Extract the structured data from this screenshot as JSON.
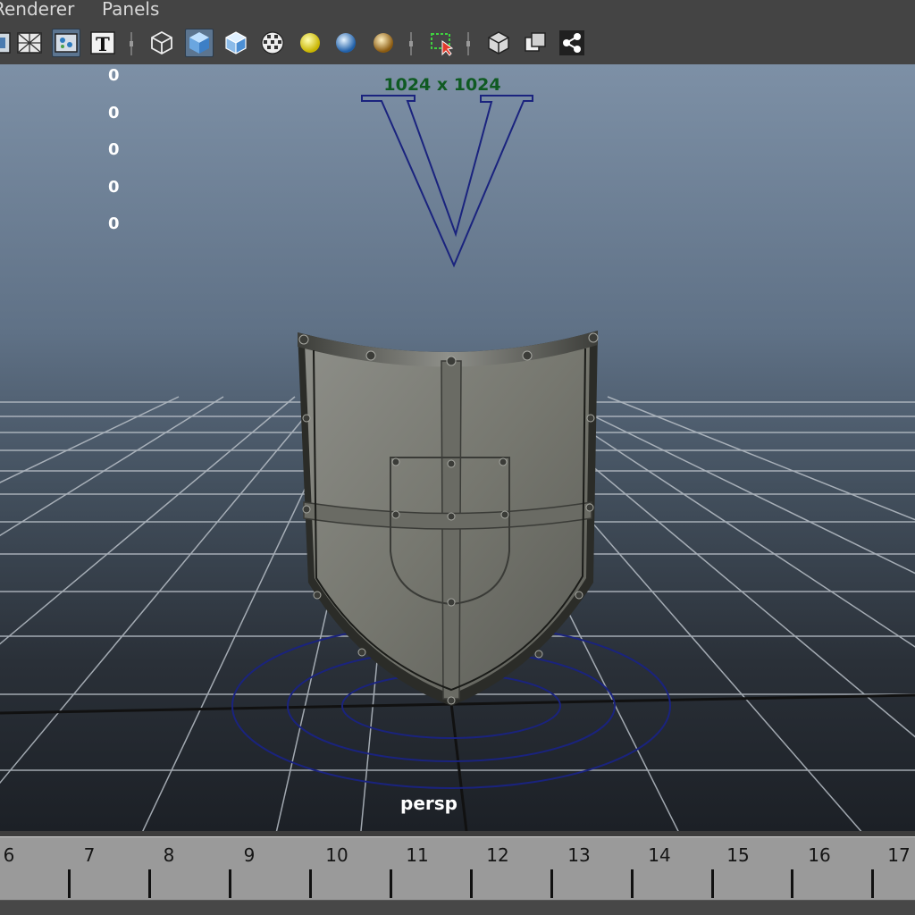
{
  "menu": {
    "items": [
      "Renderer",
      "Panels"
    ]
  },
  "toolbar": {
    "buttons": [
      {
        "icon": "camera-attributes-icon"
      },
      {
        "icon": "grid-icon"
      },
      {
        "icon": "resolution-gate-icon",
        "active": true
      },
      {
        "icon": "hud-text-icon"
      },
      {
        "icon": "wireframe-cube-icon"
      },
      {
        "icon": "smooth-shade-cube-icon",
        "active": true
      },
      {
        "icon": "shaded-wireframe-cube-icon"
      },
      {
        "icon": "textured-icon"
      },
      {
        "icon": "default-light-icon"
      },
      {
        "icon": "all-lights-icon"
      },
      {
        "icon": "use-lights-icon"
      },
      {
        "icon": "isolate-select-icon"
      },
      {
        "icon": "xray-icon"
      },
      {
        "icon": "xray-joints-icon"
      },
      {
        "icon": "share-icon"
      }
    ]
  },
  "viewport": {
    "hud_values": [
      "0",
      "0",
      "0",
      "0",
      "0"
    ],
    "resolution_label": "1024 x 1024",
    "camera_name": "persp"
  },
  "timeslider": {
    "ticks": [
      "6",
      "7",
      "8",
      "9",
      "10",
      "11",
      "12",
      "13",
      "14",
      "15",
      "16",
      "17"
    ]
  },
  "colors": {
    "ui_background": "#444444",
    "resolution_label": "#0f5a22",
    "manipulator": "#1a237e",
    "active_button": "#5c7590"
  }
}
